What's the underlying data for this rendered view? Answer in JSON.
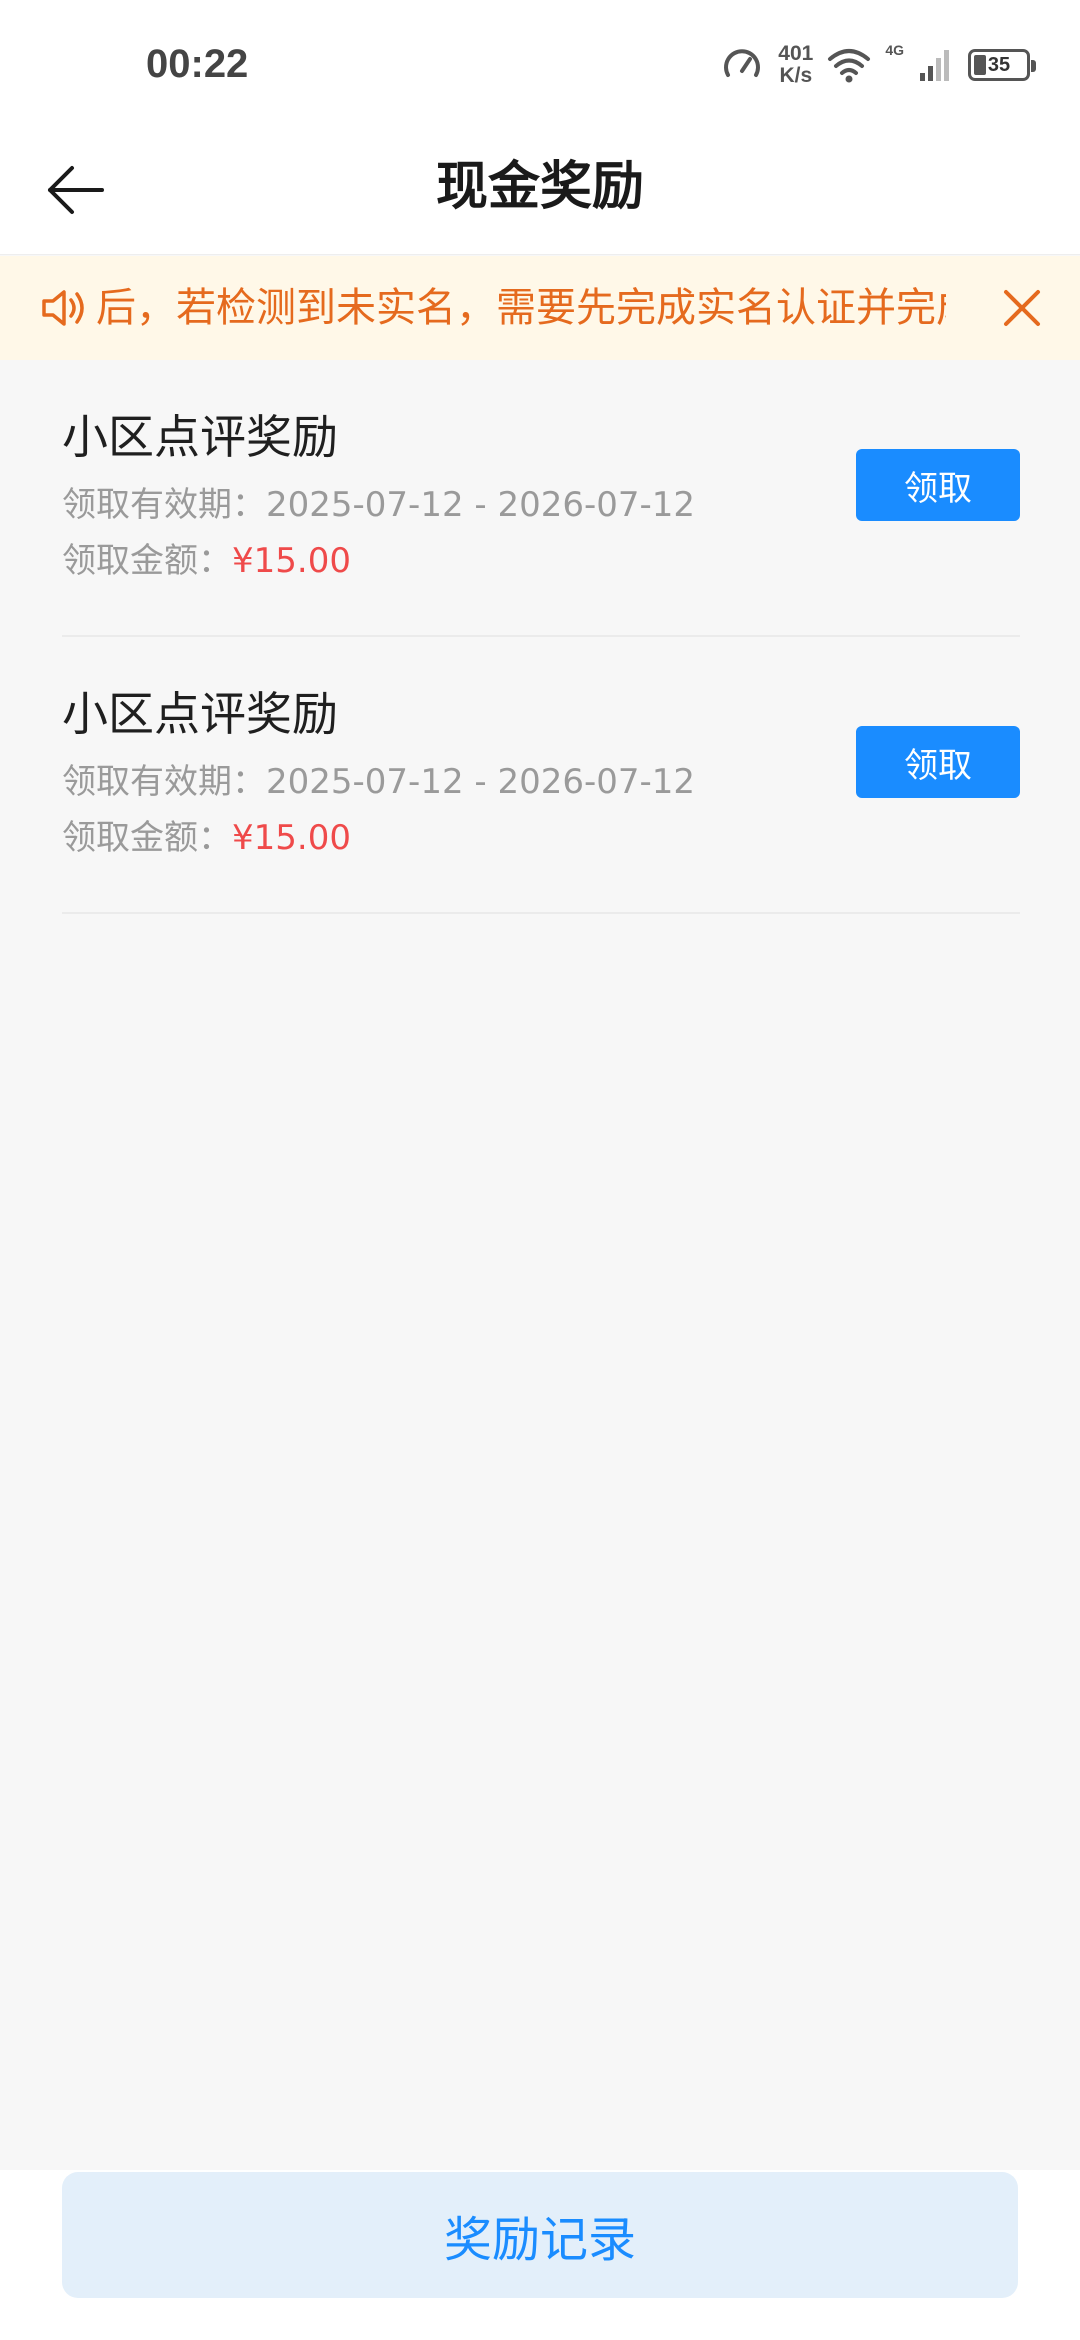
{
  "status_bar": {
    "time": "00:22",
    "net_speed_value": "401",
    "net_speed_unit": "K/s",
    "network_type": "4G",
    "battery_level": "35",
    "icons": [
      "speedometer-icon",
      "wifi-icon",
      "signal-icon",
      "battery-icon"
    ]
  },
  "header": {
    "title": "现金奖励",
    "back_icon": "arrow-left-icon"
  },
  "notice": {
    "text": "后，若检测到未实名，需要先完成实名认证并完成",
    "speaker_icon": "speaker-icon",
    "close_icon": "close-icon",
    "color": "#e56a1e",
    "background": "#fff8e8"
  },
  "rewards": [
    {
      "title": "小区点评奖励",
      "period_label": "领取有效期：",
      "period_value": "2025-07-12 - 2026-07-12",
      "amount_label": "领取金额：",
      "amount_value": "¥15.00",
      "button_label": "领取"
    },
    {
      "title": "小区点评奖励",
      "period_label": "领取有效期：",
      "period_value": "2025-07-12 - 2026-07-12",
      "amount_label": "领取金额：",
      "amount_value": "¥15.00",
      "button_label": "领取"
    }
  ],
  "bottom": {
    "records_label": "奖励记录"
  },
  "colors": {
    "accent": "#1a8cff",
    "amount": "#ef4a4a",
    "records_button_bg": "#e3effa"
  }
}
